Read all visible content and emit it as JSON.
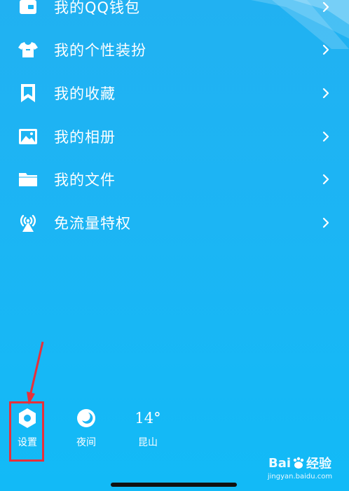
{
  "menu": {
    "items": [
      {
        "label": "我的QQ钱包",
        "icon": "wallet-icon"
      },
      {
        "label": "我的个性装扮",
        "icon": "shirt-icon"
      },
      {
        "label": "我的收藏",
        "icon": "bookmark-icon"
      },
      {
        "label": "我的相册",
        "icon": "photo-icon"
      },
      {
        "label": "我的文件",
        "icon": "folder-icon"
      },
      {
        "label": "免流量特权",
        "icon": "signal-tower-icon"
      }
    ]
  },
  "bottom": {
    "settings_label": "设置",
    "night_label": "夜间",
    "temperature": "14°",
    "city": "昆山"
  },
  "watermark": {
    "logo_text": "Bai",
    "logo_text_2": "经验",
    "url": "jingyan.baidu.com"
  },
  "colors": {
    "background": "#1CB5F4",
    "highlight": "#E8303A",
    "text": "#FFFFFF"
  }
}
